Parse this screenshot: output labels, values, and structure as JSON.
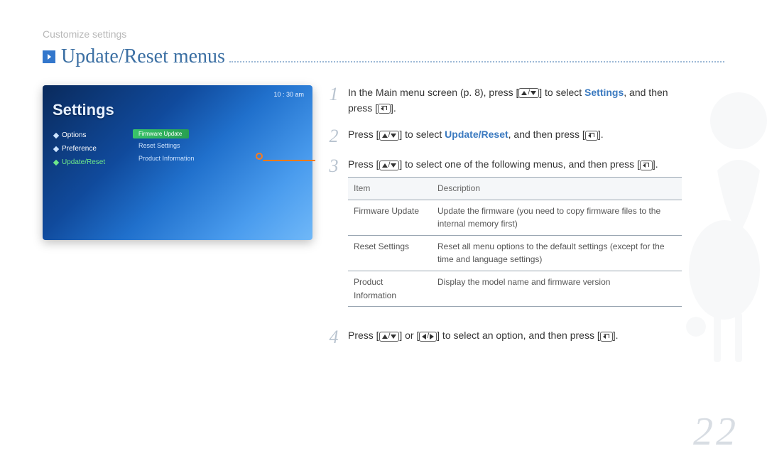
{
  "breadcrumb": "Customize settings",
  "section_title": "Update/Reset menus",
  "page_number": "22",
  "device": {
    "time": "10 : 30 am",
    "title": "Settings",
    "left_menu": [
      {
        "label": "Options",
        "active": false
      },
      {
        "label": "Preference",
        "active": false
      },
      {
        "label": "Update/Reset",
        "active": true
      }
    ],
    "right_menu": [
      {
        "label": "Firmware Update",
        "active": true
      },
      {
        "label": "Reset Settings",
        "active": false
      },
      {
        "label": "Product Information",
        "active": false
      }
    ]
  },
  "steps": {
    "s1_a": "In the Main menu screen (p. 8), press [",
    "s1_b": "] to select",
    "s1_link": "Settings",
    "s1_c": ", and then press [",
    "s1_d": "].",
    "s2_a": "Press [",
    "s2_b": "] to select ",
    "s2_link": "Update/Reset",
    "s2_c": ", and then press [",
    "s2_d": "].",
    "s3_a": "Press [",
    "s3_b": "] to select one of the following menus, and then press [",
    "s3_c": "].",
    "s4_a": "Press [",
    "s4_b": "] or [",
    "s4_c": "] to select an option, and then press [",
    "s4_d": "]."
  },
  "table": {
    "headers": [
      "Item",
      "Description"
    ],
    "rows": [
      [
        "Firmware Update",
        "Update the firmware (you need to copy firmware files to the internal memory first)"
      ],
      [
        "Reset Settings",
        "Reset all menu options to the default settings (except for the time and language settings)"
      ],
      [
        "Product Information",
        "Display the model name and firmware version"
      ]
    ]
  }
}
